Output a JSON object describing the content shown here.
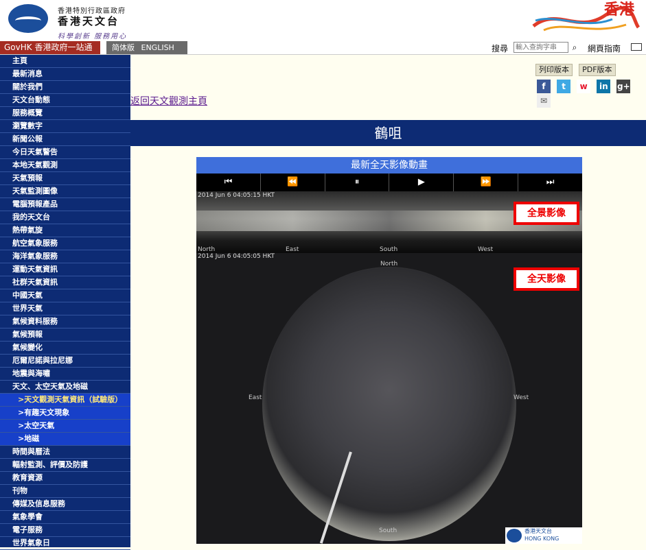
{
  "header": {
    "dept_small": "香港特別行政區政府",
    "dept_big": "香港天文台",
    "slogan": "科學創新 服務用心",
    "brand_text": "香港"
  },
  "topbar": {
    "govhk": "GovHK 香港政府一站通",
    "lang_simplified": "简体版",
    "lang_english": "ENGLISH",
    "search_label": "搜尋",
    "search_placeholder": "輸入查詢字串",
    "guide": "網頁指南"
  },
  "sidebar": {
    "items": [
      "主頁",
      "最新消息",
      "關於我們",
      "天文台動態",
      "服務概覽",
      "瀏覽數字",
      "新聞公報",
      "今日天氣警告",
      "本地天氣觀測",
      "天氣預報",
      "天氣監測圖像",
      "電腦預報產品",
      "我的天文台",
      "熱帶氣旋",
      "航空氣象服務",
      "海洋氣象服務",
      "運動天氣資訊",
      "社群天氣資訊",
      "中國天氣",
      "世界天氣",
      "氣候資料服務",
      "氣候預報",
      "氣候變化",
      "厄爾尼諾與拉尼娜",
      "地震與海嘯",
      "天文、太空天氣及地磁"
    ],
    "sub_items": [
      ">天文觀測天氣資訊（試驗版）",
      ">有趣天文現象",
      ">太空天氣",
      ">地磁"
    ],
    "items_after": [
      "時間與曆法",
      "輻射監測、評價及防護",
      "教育資源",
      "刊物",
      "傳媒及信息服務",
      "氣象學會",
      "電子服務",
      "世界氣象日"
    ]
  },
  "toolbar": {
    "print_label": "列印版本",
    "pdf_label": "PDF版本",
    "social": [
      "f",
      "t",
      "w",
      "in",
      "g+",
      "✉"
    ]
  },
  "main": {
    "back_link": "返回天文觀測主頁",
    "page_title": "鶴咀"
  },
  "player": {
    "title": "最新全天影像動畫",
    "controls": [
      "⏮",
      "⏪",
      "⏸",
      "▶",
      "⏩",
      "⏭"
    ],
    "pano_stamp": "2014 Jun 6  04:05:15 HKT",
    "pano_label": "全景影像",
    "pano_dirs": [
      "North",
      "East",
      "South",
      "West"
    ],
    "allsky_stamp": "2014 Jun 6  04:05:05 HKT",
    "allsky_label": "全天影像",
    "allsky_dirs": {
      "north": "North",
      "east": "East",
      "west": "West",
      "south": "South"
    },
    "hko_logo_cn": "香港天文台",
    "hko_logo_en": "HONG KONG OBSERVATORY"
  },
  "colors": {
    "sidebar": "#0d2b74",
    "title_bar": "#0d2b74",
    "player_title": "#3f6fdb",
    "label_border": "#ee0000"
  }
}
